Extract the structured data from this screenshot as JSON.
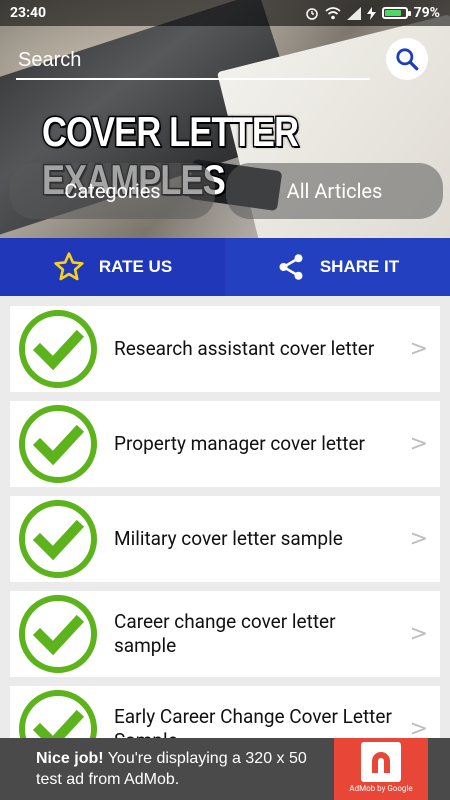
{
  "status_bar": {
    "time": "23:40",
    "battery": "79%",
    "battery_level": 0.79
  },
  "header": {
    "search_placeholder": "Search",
    "title": "COVER LETTER EXAMPLES",
    "categories_label": "Categories",
    "all_articles_label": "All Articles"
  },
  "actions": {
    "rate_label": "RATE US",
    "share_label": "SHARE IT"
  },
  "list": {
    "items": [
      "Research assistant cover letter",
      "Property manager cover letter",
      "Military cover letter sample",
      "Career change cover letter sample",
      "Early Career Change Cover Letter Sample"
    ],
    "chevron": ">"
  },
  "ad": {
    "headline": "Nice job!",
    "body": " You're displaying a 320 x 50 test ad from AdMob.",
    "logo_caption": "AdMob by Google"
  },
  "colors": {
    "action_bar": "#1f37b8",
    "check_green": "#5cb31b",
    "ad_background": "#4a4a4a",
    "ad_logo": "#e84637"
  }
}
